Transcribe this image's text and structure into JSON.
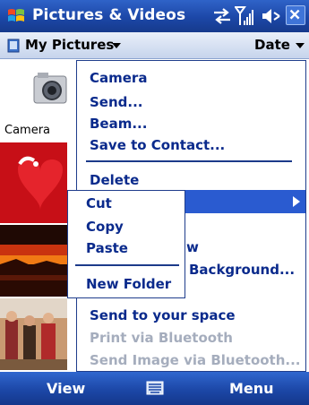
{
  "titlebar": {
    "title": "Pictures & Videos",
    "icons": [
      "windows-start-icon",
      "sync-icon",
      "signal-icon",
      "volume-icon",
      "close-icon"
    ],
    "close_label": "x"
  },
  "toolbar": {
    "folder_label": "My Pictures",
    "sort_label": "Date"
  },
  "thumbnails": {
    "camera_label": "Camera",
    "items": [
      "camera",
      "heart",
      "sunset",
      "people"
    ]
  },
  "menu": {
    "items": [
      {
        "label": "Camera",
        "enabled": true
      },
      {
        "label": "Send...",
        "enabled": true
      },
      {
        "label": "Beam...",
        "enabled": true
      },
      {
        "label": "Save to Contact...",
        "enabled": true
      },
      {
        "label": "Delete",
        "enabled": true
      },
      {
        "label": "",
        "enabled": true,
        "highlighted": true,
        "submenu": true
      },
      {
        "label": "w",
        "enabled": true
      },
      {
        "label": "Background...",
        "enabled": true
      },
      {
        "label": "Send to your space",
        "enabled": true
      },
      {
        "label": "Print via Bluetooth",
        "enabled": false
      },
      {
        "label": "Send Image via Bluetooth...",
        "enabled": false
      }
    ]
  },
  "submenu": {
    "items": [
      {
        "label": "Cut"
      },
      {
        "label": "Copy"
      },
      {
        "label": "Paste"
      },
      {
        "label": "New Folder"
      }
    ]
  },
  "softkeys": {
    "left": "View",
    "right": "Menu",
    "center_icon": "keyboard-icon"
  },
  "colors": {
    "titlebar": "#1c47a7",
    "highlight": "#2a5bd0",
    "menu_text": "#0a2a8c",
    "disabled_text": "#a5adbd"
  }
}
